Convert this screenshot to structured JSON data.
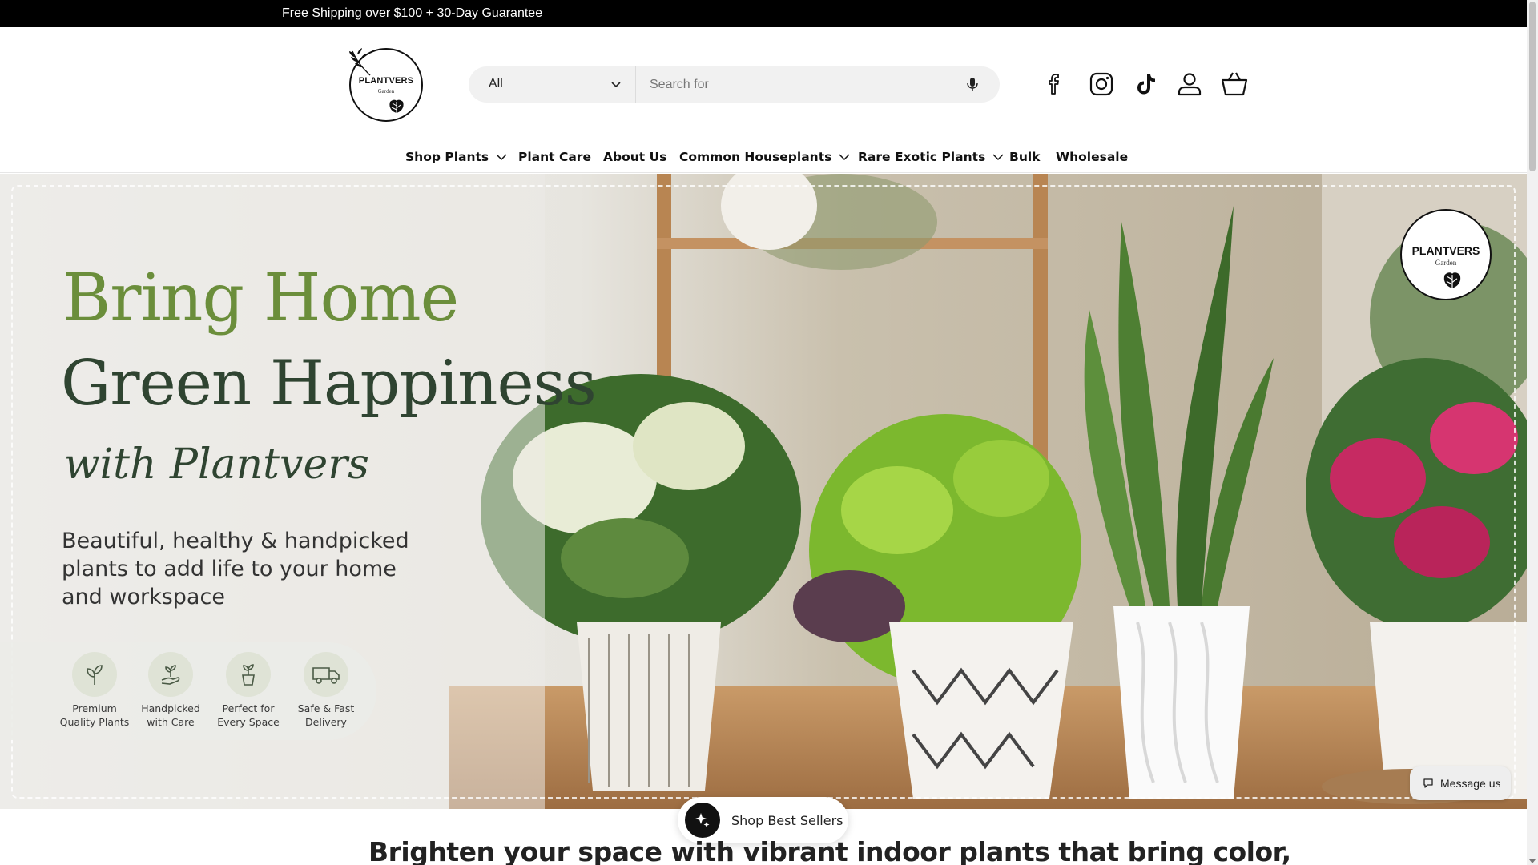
{
  "announcement": {
    "text": "Free Shipping over $100 + 30-Day Guarantee"
  },
  "brand": {
    "name": "PLANTVERS",
    "sub": "Garden"
  },
  "search": {
    "category": "All",
    "placeholder": "Search for"
  },
  "header_icons": [
    "facebook-icon",
    "instagram-icon",
    "tiktok-icon",
    "account-icon",
    "basket-icon"
  ],
  "nav": {
    "items": [
      {
        "label": "Shop Plants",
        "dropdown": true
      },
      {
        "label": "Plant Care",
        "dropdown": false
      },
      {
        "label": "About Us",
        "dropdown": false
      },
      {
        "label": "Common Houseplants",
        "dropdown": true
      },
      {
        "label": "Rare Exotic Plants",
        "dropdown": true
      },
      {
        "label": "Bulk",
        "dropdown": false
      },
      {
        "label": "Wholesale",
        "dropdown": false
      }
    ]
  },
  "hero": {
    "line1": "Bring Home",
    "line2": "Green Happiness",
    "script": "with Plantvers",
    "description": "Beautiful, healthy & handpicked plants to add life to your home and workspace",
    "features": [
      {
        "line1": "Premium",
        "line2": "Quality Plants",
        "icon": "plant-icon"
      },
      {
        "line1": "Handpicked",
        "line2": "with Care",
        "icon": "hand-plant-icon"
      },
      {
        "line1": "Perfect for",
        "line2": "Every Space",
        "icon": "potted-plant-icon"
      },
      {
        "line1": "Safe & Fast",
        "line2": "Delivery",
        "icon": "delivery-truck-icon"
      }
    ],
    "corner_logo": {
      "name": "PLANTVERS",
      "sub": "Garden"
    }
  },
  "chat": {
    "label": "Message us"
  },
  "floating": {
    "label": "Shop Best Sellers"
  },
  "section": {
    "heading": "Brighten your space with vibrant indoor plants that bring color,"
  },
  "colors": {
    "accent_green": "#6b8e3b",
    "dark_green": "#2f4431",
    "announcement_bg": "#000000"
  }
}
